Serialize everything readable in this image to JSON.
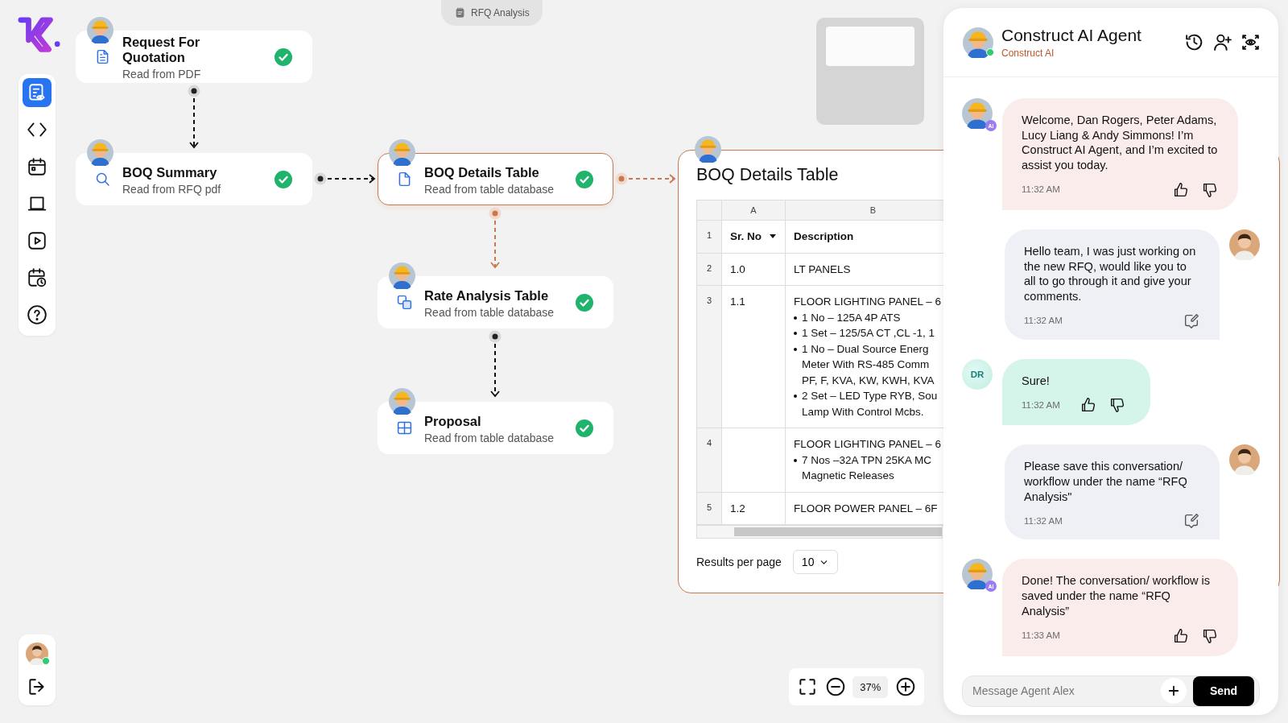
{
  "tab": {
    "label": "RFQ Analysis"
  },
  "sidebar": {
    "items": [
      {
        "selected": true
      },
      {
        "selected": false
      },
      {
        "selected": false
      },
      {
        "selected": false
      },
      {
        "selected": false
      },
      {
        "selected": false
      },
      {
        "selected": false
      }
    ]
  },
  "user": {
    "online": true
  },
  "nodes": [
    {
      "title": "Request For Quotation",
      "subtitle": "Read from PDF",
      "done": true,
      "selected": false
    },
    {
      "title": "BOQ Summary",
      "subtitle": "Read from RFQ pdf",
      "done": true,
      "selected": false
    },
    {
      "title": "BOQ Details Table",
      "subtitle": "Read from table database",
      "done": true,
      "selected": true
    },
    {
      "title": "Rate Analysis Table",
      "subtitle": "Read from table database",
      "done": true,
      "selected": false
    },
    {
      "title": "Proposal",
      "subtitle": "Read from table database",
      "done": true,
      "selected": false
    }
  ],
  "table": {
    "title": "BOQ Details Table",
    "column_letters": [
      "A",
      "B"
    ],
    "rows": [
      {
        "row_number": "1",
        "header": true,
        "sr_no": "Sr. No",
        "description": "Description"
      },
      {
        "row_number": "2",
        "header": false,
        "sr_no": "1.0",
        "description": "LT PANELS"
      },
      {
        "row_number": "3",
        "header": false,
        "sr_no": "1.1",
        "description": "FLOOR LIGHTING PANEL – 6",
        "bullets": [
          [
            "1 No – 125A  4P  ATS"
          ],
          [
            "1 Set – 125/5A CT ,CL -1, 1"
          ],
          [
            "1 No –  Dual Source Energ",
            "Meter With RS-485 Comm",
            "PF, F, KVA, KW, KWH, KVA"
          ],
          [
            "2 Set –  LED Type RYB, Sou",
            "Lamp With Control Mcbs."
          ]
        ]
      },
      {
        "row_number": "4",
        "header": false,
        "sr_no": "",
        "description": "FLOOR LIGHTING PANEL – 6",
        "bullets": [
          [
            "7 Nos –32A TPN 25KA MC",
            "Magnetic Releases"
          ]
        ]
      },
      {
        "row_number": "5",
        "header": false,
        "sr_no": "1.2",
        "description": "FLOOR POWER PANEL – 6F"
      }
    ],
    "results_per_page": {
      "label": "Results per page",
      "value": "10"
    }
  },
  "zoom": {
    "level": "37%"
  },
  "chat": {
    "title": "Construct AI Agent",
    "subtitle": "Construct AI",
    "online": true,
    "messages": [
      {
        "kind": "agent",
        "badge": "AI",
        "text": "Welcome, Dan Rogers, Peter Adams, Lucy Liang & Andy Simmons! I’m Construct AI Agent, and I’m excited to assist you today.",
        "time": "11:32 AM"
      },
      {
        "kind": "member",
        "text": "Hello team, I was just working on the new RFQ, would like you to all to go through it and give your comments.",
        "time": "11:32 AM"
      },
      {
        "kind": "initials",
        "initials": "DR",
        "text": "Sure!",
        "time": "11:32 AM"
      },
      {
        "kind": "member",
        "text": "Please save this conversation/ workflow under the name “RFQ Analysis\"",
        "time": "11:32 AM"
      },
      {
        "kind": "agent",
        "badge": "AI",
        "text": "Done! The conversation/ workflow is saved under the name “RFQ Analysis”",
        "time": "11:33 AM"
      }
    ],
    "input": {
      "placeholder": "Message Agent Alex"
    },
    "send": "Send"
  }
}
